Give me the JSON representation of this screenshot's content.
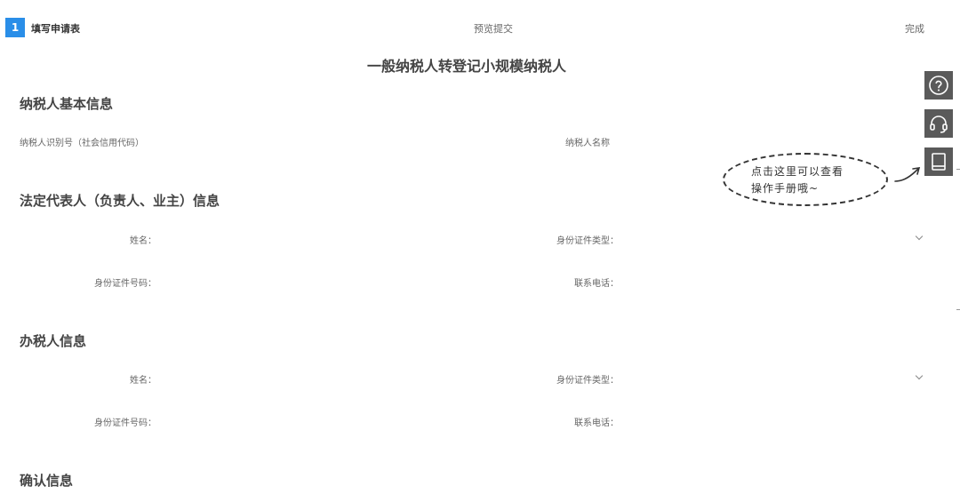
{
  "steps": [
    {
      "number": "1",
      "label": "填写申请表"
    },
    {
      "label": "预览提交"
    },
    {
      "label": "完成"
    }
  ],
  "page_title": "一般纳税人转登记小规模纳税人",
  "sections": {
    "basic": {
      "title": "纳税人基本信息",
      "taxpayer_id_label": "纳税人识别号（社会信用代码）",
      "taxpayer_name_label": "纳税人名称"
    },
    "legal_rep": {
      "title": "法定代表人（负责人、业主）信息",
      "name_label": "姓名：",
      "id_type_label": "身份证件类型：",
      "id_number_label": "身份证件号码：",
      "phone_label": "联系电话："
    },
    "tax_agent": {
      "title": "办税人信息",
      "name_label": "姓名：",
      "id_type_label": "身份证件类型：",
      "id_number_label": "身份证件号码：",
      "phone_label": "联系电话："
    },
    "confirm": {
      "title": "确认信息"
    }
  },
  "help_bubble": {
    "line1": "点击这里可以查看",
    "line2": "操作手册哦~"
  },
  "side_tools": [
    {
      "icon": "question-icon"
    },
    {
      "icon": "headset-icon"
    },
    {
      "icon": "manual-book-icon"
    }
  ],
  "colors": {
    "step_active": "#2a8ee8",
    "side_tool_bg": "#5a5a5a"
  }
}
